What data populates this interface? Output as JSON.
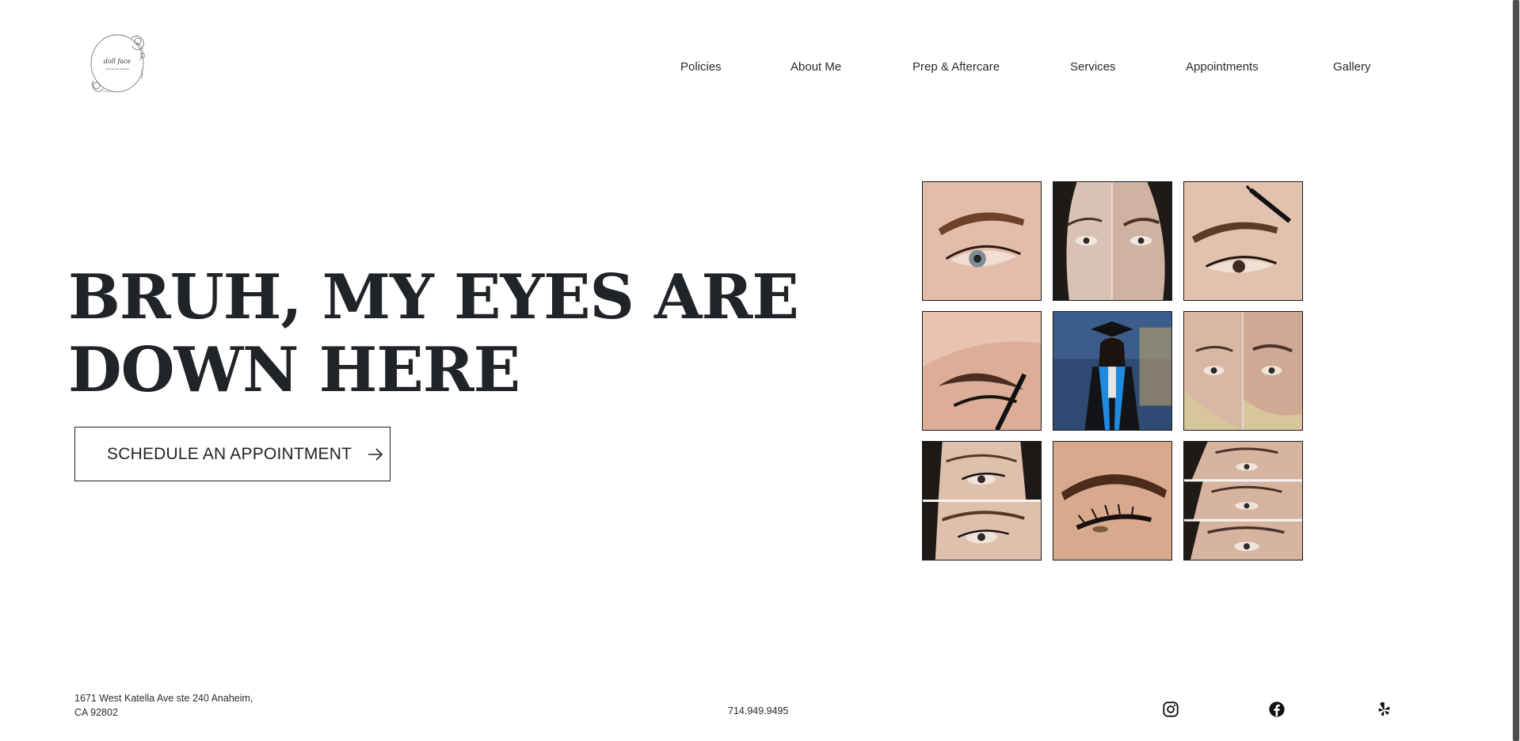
{
  "brand": {
    "logo_text": "doll face",
    "logo_subtext": "permanent makeup"
  },
  "nav": {
    "items": [
      {
        "label": "Policies"
      },
      {
        "label": "About Me"
      },
      {
        "label": "Prep & Aftercare"
      },
      {
        "label": "Services"
      },
      {
        "label": "Appointments"
      },
      {
        "label": "Gallery"
      }
    ]
  },
  "hero": {
    "headline_line1": "BRUH, MY EYES ARE",
    "headline_line2": "DOWN HERE",
    "cta_label": "SCHEDULE AN APPOINTMENT",
    "cta_icon": "arrow-right-icon"
  },
  "gallery": {
    "tiles": [
      {
        "name": "gallery-photo-brow-closeup",
        "subject": "eyebrow close-up"
      },
      {
        "name": "gallery-photo-before-after-split",
        "subject": "before and after"
      },
      {
        "name": "gallery-photo-spoolie-brow",
        "subject": "brow with spoolie"
      },
      {
        "name": "gallery-photo-lash-spoolie",
        "subject": "lashes with spoolie"
      },
      {
        "name": "gallery-photo-graduation",
        "subject": "graduation portrait"
      },
      {
        "name": "gallery-photo-before-after-blonde",
        "subject": "before and after"
      },
      {
        "name": "gallery-photo-eyeliner-collage",
        "subject": "eyeliner collage"
      },
      {
        "name": "gallery-photo-lash-closeup",
        "subject": "lash close-up"
      },
      {
        "name": "gallery-photo-brow-collage",
        "subject": "brow collage"
      }
    ]
  },
  "footer": {
    "address_line1": "1671 West Katella Ave ste 240 Anaheim,",
    "address_line2": "CA 92802",
    "phone": "714.949.9495",
    "social": [
      {
        "name": "instagram-icon"
      },
      {
        "name": "facebook-icon"
      },
      {
        "name": "yelp-icon"
      }
    ]
  },
  "colors": {
    "text": "#202328",
    "background": "#ffffff",
    "border": "#1a1a1a"
  }
}
